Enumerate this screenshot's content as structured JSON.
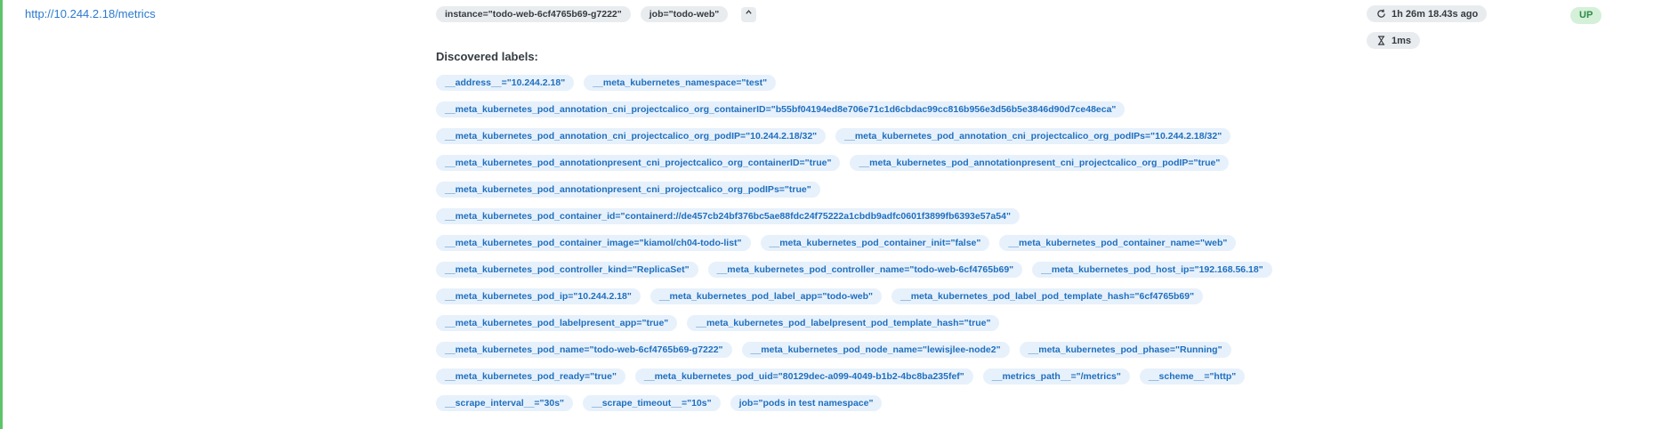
{
  "target": {
    "endpoint": "http://10.244.2.18/metrics",
    "labels": [
      "instance=\"todo-web-6cf4765b69-g7222\"",
      "job=\"todo-web\""
    ],
    "toggle_icon": "chevron-up-icon",
    "last_scrape": "1h 26m 18.43s ago",
    "last_scrape_icon": "refresh-icon",
    "scrape_duration": "1ms",
    "scrape_duration_icon": "hourglass-icon",
    "state": "UP"
  },
  "discovered": {
    "title": "Discovered labels:",
    "rows": [
      [
        "__address__=\"10.244.2.18\"",
        "__meta_kubernetes_namespace=\"test\""
      ],
      [
        "__meta_kubernetes_pod_annotation_cni_projectcalico_org_containerID=\"b55bf04194ed8e706e71c1d6cbdac99cc816b956e3d56b5e3846d90d7ce48eca\""
      ],
      [
        "__meta_kubernetes_pod_annotation_cni_projectcalico_org_podIP=\"10.244.2.18/32\"",
        "__meta_kubernetes_pod_annotation_cni_projectcalico_org_podIPs=\"10.244.2.18/32\""
      ],
      [
        "__meta_kubernetes_pod_annotationpresent_cni_projectcalico_org_containerID=\"true\"",
        "__meta_kubernetes_pod_annotationpresent_cni_projectcalico_org_podIP=\"true\""
      ],
      [
        "__meta_kubernetes_pod_annotationpresent_cni_projectcalico_org_podIPs=\"true\""
      ],
      [
        "__meta_kubernetes_pod_container_id=\"containerd://de457cb24bf376bc5ae88fdc24f75222a1cbdb9adfc0601f3899fb6393e57a54\""
      ],
      [
        "__meta_kubernetes_pod_container_image=\"kiamol/ch04-todo-list\"",
        "__meta_kubernetes_pod_container_init=\"false\"",
        "__meta_kubernetes_pod_container_name=\"web\""
      ],
      [
        "__meta_kubernetes_pod_controller_kind=\"ReplicaSet\"",
        "__meta_kubernetes_pod_controller_name=\"todo-web-6cf4765b69\"",
        "__meta_kubernetes_pod_host_ip=\"192.168.56.18\""
      ],
      [
        "__meta_kubernetes_pod_ip=\"10.244.2.18\"",
        "__meta_kubernetes_pod_label_app=\"todo-web\"",
        "__meta_kubernetes_pod_label_pod_template_hash=\"6cf4765b69\""
      ],
      [
        "__meta_kubernetes_pod_labelpresent_app=\"true\"",
        "__meta_kubernetes_pod_labelpresent_pod_template_hash=\"true\""
      ],
      [
        "__meta_kubernetes_pod_name=\"todo-web-6cf4765b69-g7222\"",
        "__meta_kubernetes_pod_node_name=\"lewisjlee-node2\"",
        "__meta_kubernetes_pod_phase=\"Running\""
      ],
      [
        "__meta_kubernetes_pod_ready=\"true\"",
        "__meta_kubernetes_pod_uid=\"80129dec-a099-4049-b1b2-4bc8ba235fef\"",
        "__metrics_path__=\"/metrics\"",
        "__scheme__=\"http\""
      ],
      [
        "__scrape_interval__=\"30s\"",
        "__scrape_timeout__=\"10s\"",
        "job=\"pods in test namespace\""
      ]
    ]
  },
  "colors": {
    "link": "#2a7ad0",
    "label_blue_bg": "#e7f1fb",
    "label_blue_text": "#1f6fbf",
    "up_bg": "#d4f0d9",
    "up_text": "#2e8a45",
    "row_border": "#5ec46a"
  }
}
